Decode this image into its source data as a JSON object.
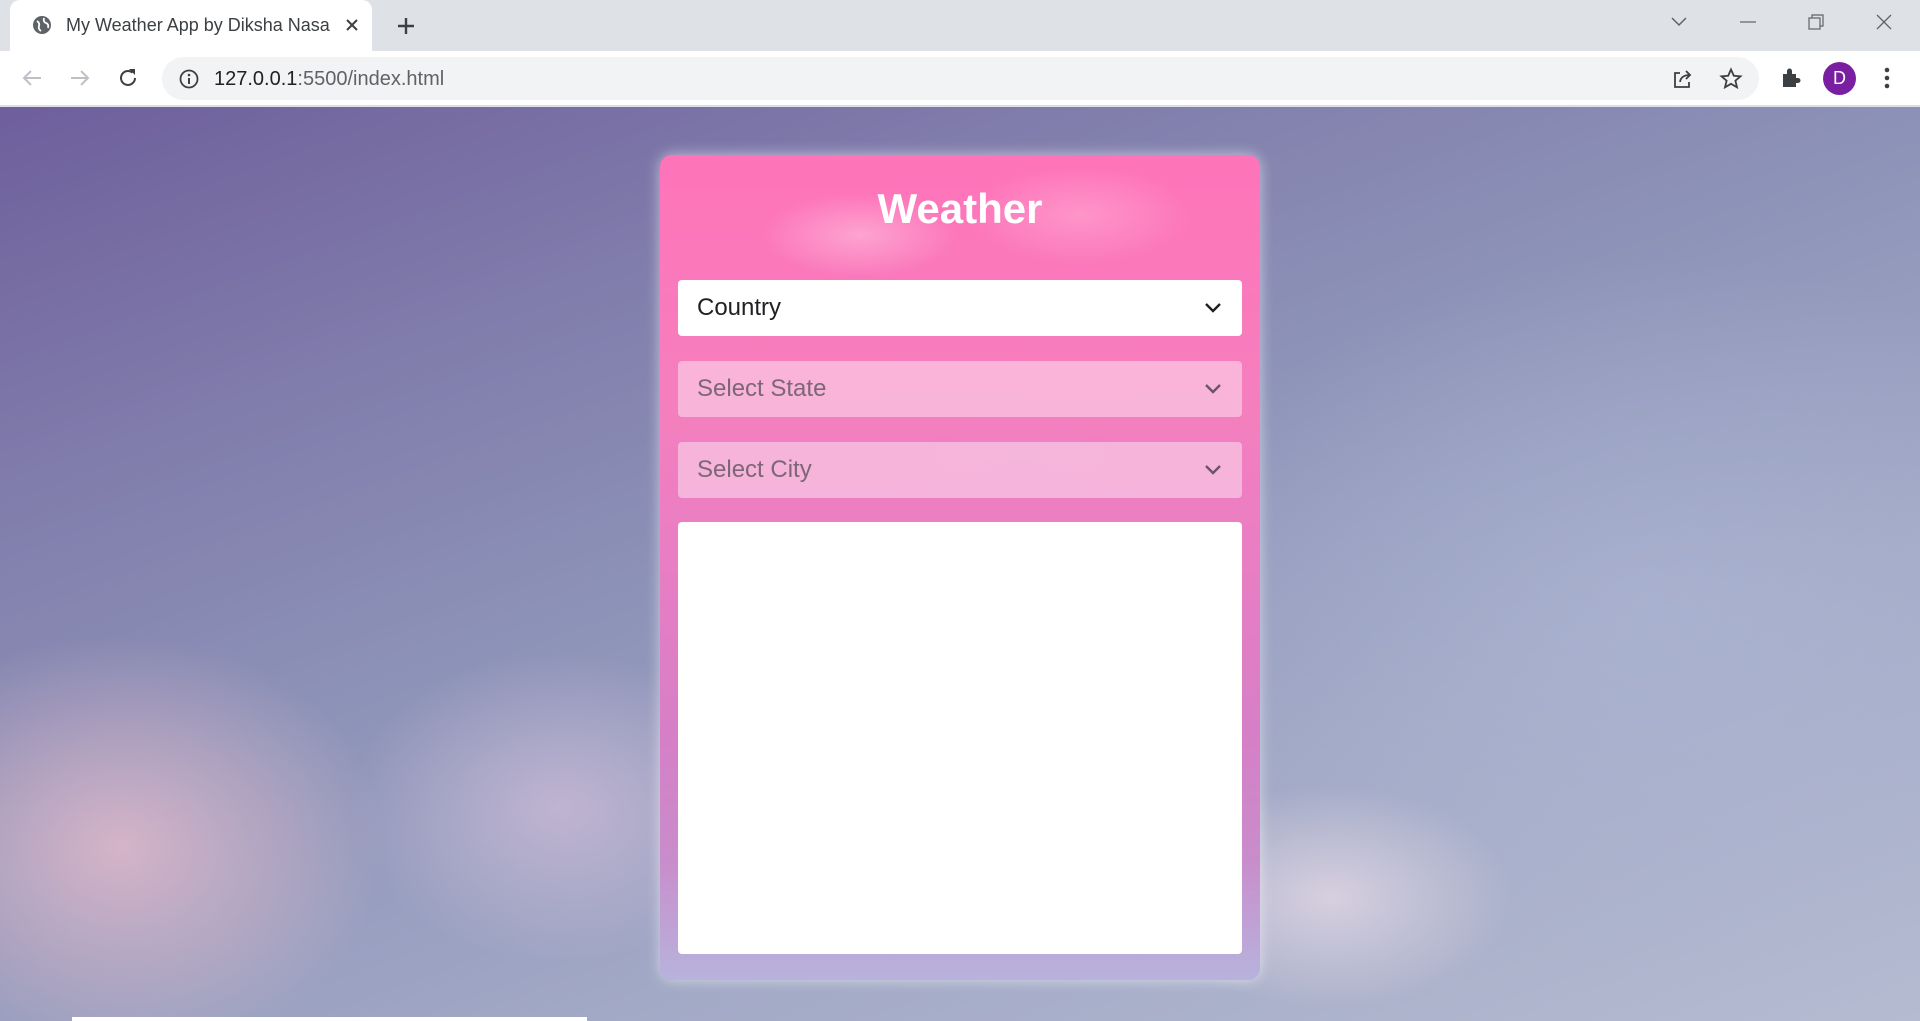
{
  "browser": {
    "tab_title": "My Weather App by Diksha Nasa",
    "url_host": "127.0.0.1",
    "url_rest": ":5500/index.html",
    "profile_initial": "D",
    "icons": [
      "globe-icon",
      "close-icon",
      "plus-icon",
      "back-icon",
      "forward-icon",
      "reload-icon",
      "info-icon",
      "share-icon",
      "star-icon",
      "extensions-icon",
      "menu-icon"
    ]
  },
  "app": {
    "title": "Weather",
    "country_select": {
      "value": "Country"
    },
    "state_select": {
      "value": "Select State"
    },
    "city_select": {
      "value": "Select City"
    },
    "colors": {
      "card_top": "#ff73b9",
      "card_bottom": "#b7b3dc",
      "text_white": "#ffffff"
    }
  }
}
